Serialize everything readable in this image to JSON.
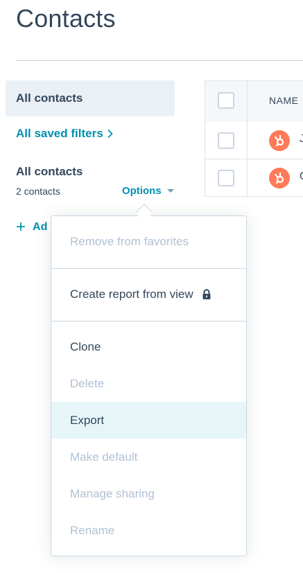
{
  "page": {
    "title": "Contacts"
  },
  "sidebar": {
    "active_view": "All contacts",
    "saved_filters_label": "All saved filters",
    "current_view_name": "All contacts",
    "current_view_count": "2 contacts",
    "options_label": "Options",
    "add_view_label": "Ad"
  },
  "table": {
    "header_name": "NAME",
    "rows": [
      {
        "name_clip": "J"
      },
      {
        "name_clip": "C"
      }
    ]
  },
  "options_menu": {
    "items": [
      {
        "label": "Remove from favorites",
        "state": "disabled"
      },
      {
        "label": "Create report from view",
        "state": "enabled",
        "icon": "lock-icon"
      },
      {
        "label": "Clone",
        "state": "enabled"
      },
      {
        "label": "Delete",
        "state": "disabled"
      },
      {
        "label": "Export",
        "state": "highlighted"
      },
      {
        "label": "Make default",
        "state": "disabled"
      },
      {
        "label": "Manage sharing",
        "state": "disabled"
      },
      {
        "label": "Rename",
        "state": "disabled"
      }
    ]
  },
  "colors": {
    "accent": "#0091ae",
    "text": "#33475b",
    "disabled_text": "#b0c1d4",
    "active_bg": "#eaf0f6",
    "highlight_bg": "#e5f5f8",
    "avatar": "#ff7a59"
  }
}
